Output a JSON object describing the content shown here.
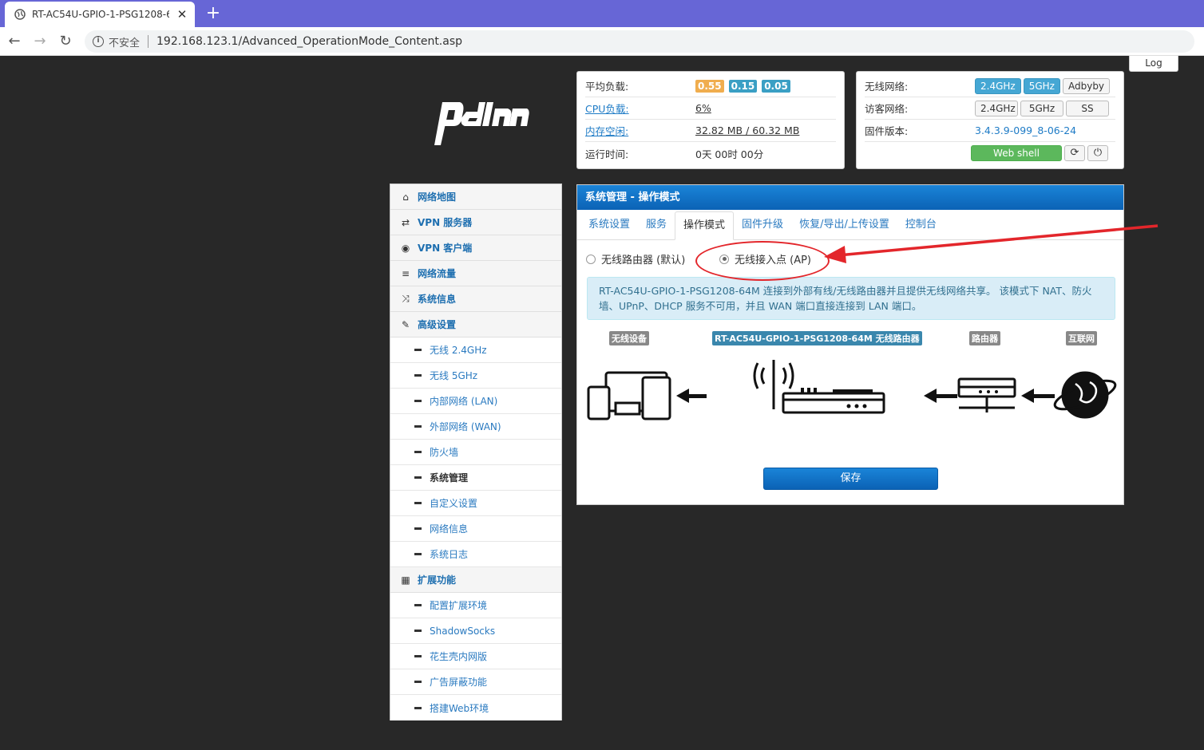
{
  "browser": {
    "tab_title": "RT-AC54U-GPIO-1-PSG1208-6",
    "new_tab": "+",
    "close": "✕",
    "insecure": "不安全",
    "url": "192.168.123.1/Advanced_OperationMode_Content.asp"
  },
  "header": {
    "log": "Log"
  },
  "status_left": {
    "load_label": "平均负载:",
    "load_values": [
      "0.55",
      "0.15",
      "0.05"
    ],
    "cpu_label": "CPU负载:",
    "cpu_value": "6%",
    "mem_label": "内存空闲:",
    "mem_value": "32.82 MB / 60.32 MB",
    "uptime_label": "运行时间:",
    "uptime_value": "0天 00时 00分"
  },
  "status_right": {
    "wifi_label": "无线网络:",
    "wifi_buttons": [
      "2.4GHz",
      "5GHz",
      "Adbyby"
    ],
    "guest_label": "访客网络:",
    "guest_buttons": [
      "2.4GHz",
      "5GHz",
      "SS"
    ],
    "fw_label": "固件版本:",
    "fw_value": "3.4.3.9-099_8-06-24",
    "webshell": "Web shell",
    "refresh_icon": "⟳",
    "power_icon": "⏻"
  },
  "sidebar": {
    "items": [
      {
        "icon": "⌂",
        "label": "网络地图"
      },
      {
        "icon": "⇄",
        "label": "VPN 服务器"
      },
      {
        "icon": "◉",
        "label": "VPN 客户端"
      },
      {
        "icon": "≡",
        "label": "网络流量"
      },
      {
        "icon": "⤨",
        "label": "系统信息"
      },
      {
        "icon": "✎",
        "label": "高级设置"
      }
    ],
    "advanced_sub": [
      "无线 2.4GHz",
      "无线 5GHz",
      "内部网络 (LAN)",
      "外部网络 (WAN)",
      "防火墙",
      "系统管理",
      "自定义设置",
      "网络信息",
      "系统日志"
    ],
    "ext": {
      "icon": "▦",
      "label": "扩展功能"
    },
    "ext_sub": [
      "配置扩展环境",
      "ShadowSocks",
      "花生壳内网版",
      "广告屏蔽功能",
      "搭建Web环境"
    ]
  },
  "main": {
    "title": "系统管理 - 操作模式",
    "tabs": [
      "系统设置",
      "服务",
      "操作模式",
      "固件升级",
      "恢复/导出/上传设置",
      "控制台"
    ],
    "radio_router": "无线路由器 (默认)",
    "radio_ap": "无线接入点 (AP)",
    "info": "RT-AC54U-GPIO-1-PSG1208-64M 连接到外部有线/无线路由器并且提供无线网络共享。 该模式下 NAT、防火墙、UPnP、DHCP 服务不可用，并且 WAN 端口直接连接到 LAN 端口。",
    "diagram_labels": [
      "无线设备",
      "RT-AC54U-GPIO-1-PSG1208-64M 无线路由器",
      "路由器",
      "互联网"
    ],
    "save": "保存"
  },
  "colors": {
    "load_orange": "#f0ad4e",
    "load_teal": "#3a9fc4",
    "accent_blue": "#1a84d8",
    "annotation_red": "#e3262b"
  }
}
